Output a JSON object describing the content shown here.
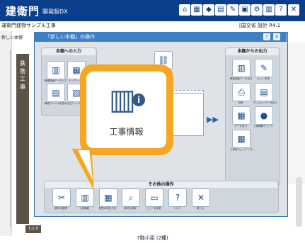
{
  "app": {
    "brand": "建衛門",
    "brand_sub": "開発版DX"
  },
  "toolbar": {
    "icons": [
      "home-icon",
      "document-icon",
      "swap-icon",
      "sheet-icon",
      "edit-icon",
      "save-icon",
      "gear-icon",
      "book-icon",
      "help-icon",
      "close-icon"
    ],
    "glyphs": [
      "⌂",
      "▦",
      "◆",
      "▤",
      "✎",
      "▣",
      "⚙",
      "▥",
      "?",
      "✕"
    ]
  },
  "document": {
    "title": "運衛門建物サンプル工事",
    "right_info": "[国交省 設計 R4.1",
    "left_tab": "新しい本棚"
  },
  "side": {
    "label": "鉄筋工事"
  },
  "modal": {
    "title": "「新しい本棚」の操作",
    "help_glyph": "?",
    "close_glyph": "✕"
  },
  "input_panel": {
    "title": "本棚への入力",
    "buttons": [
      {
        "glyph": "▥",
        "label": "構造図面データ入力"
      },
      {
        "glyph": "▦",
        "label": "テンプレート"
      },
      {
        "glyph": "▤",
        "label": "構造ファイルを読み込む"
      },
      {
        "glyph": "▧",
        "label": "ファイル"
      }
    ]
  },
  "output_panel": {
    "title": "本棚からの出力",
    "buttons": [
      {
        "glyph": "▥",
        "label": "構造図面データ出力"
      },
      {
        "glyph": "✎",
        "label": "ビュー作成"
      },
      {
        "glyph": "⎙",
        "label": "印刷"
      },
      {
        "glyph": "▤",
        "label": "プレビューデータ出力"
      },
      {
        "glyph": "▦",
        "label": "データ出力"
      },
      {
        "glyph": "●",
        "label": "工事情報チェック"
      },
      {
        "glyph": "▦",
        "label": "工事用チェックリスト"
      }
    ]
  },
  "middle": {
    "top_icon_glyph": "⛓",
    "arrow": "▶▶"
  },
  "other_panel": {
    "title": "その他の操作",
    "buttons": [
      {
        "glyph": "✂",
        "label": "部材の整理"
      },
      {
        "glyph": "▥",
        "label": "工事情報"
      },
      {
        "glyph": "▦",
        "label": "鉄筋の表示方法"
      },
      {
        "glyph": "⌕",
        "label": "部材を検索"
      },
      {
        "glyph": "▭",
        "label": "ビューを変更"
      },
      {
        "glyph": "?",
        "label": "ヘルプ"
      },
      {
        "glyph": "✕",
        "label": "閉じる"
      }
    ]
  },
  "callout": {
    "label": "工事情報",
    "icon_glyph": "▥",
    "info_glyph": "i",
    "accent": "#f5a623"
  },
  "status": {
    "floor": "7階小梁 (2種)",
    "zoom": "1:1.0"
  },
  "colors": {
    "appbar": "#0b3f8c",
    "modal_title": "#3f7fc6",
    "side_bar": "#5d5447"
  }
}
